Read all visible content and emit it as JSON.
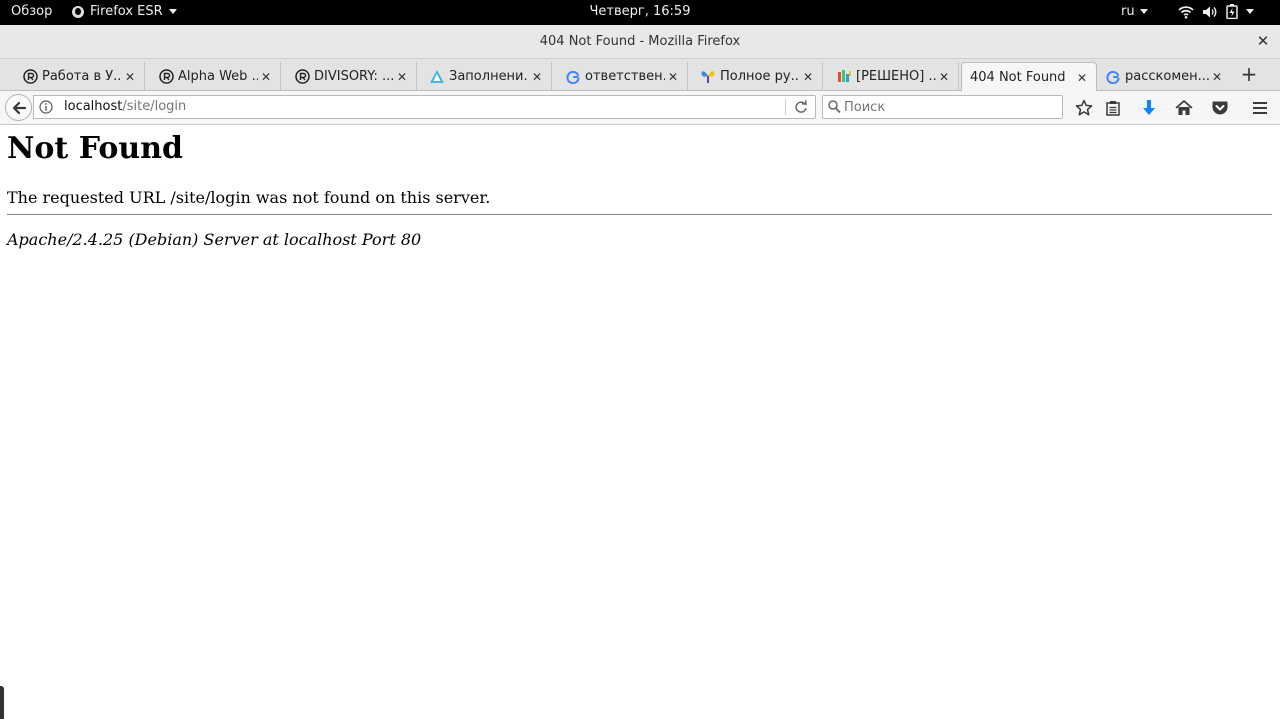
{
  "topbar": {
    "activities": "Обзор",
    "app_name": "Firefox ESR",
    "clock": "Четверг, 16:59",
    "language": "ru",
    "icons": [
      "wifi-icon",
      "volume-icon",
      "battery-icon"
    ]
  },
  "window": {
    "title": "404 Not Found - Mozilla Firefox"
  },
  "tabs": [
    {
      "label": "Работа в У...",
      "favicon": "circled-r-icon"
    },
    {
      "label": "Alpha Web ...",
      "favicon": "circled-r-icon"
    },
    {
      "label": "DIVISORY: ...",
      "favicon": "circled-r-icon"
    },
    {
      "label": "Заполнени...",
      "favicon": "triangle-logo-icon"
    },
    {
      "label": "ответствен...",
      "favicon": "google-icon"
    },
    {
      "label": "Полное ру...",
      "favicon": "butterfly-icon"
    },
    {
      "label": "[РЕШЕНО] ...",
      "favicon": "forum-icon"
    },
    {
      "label": "404 Not Found",
      "favicon": "none",
      "active": true
    },
    {
      "label": "расскомен...",
      "favicon": "google-icon"
    }
  ],
  "navbar": {
    "url_host": "localhost",
    "url_path": "/site/login",
    "search_placeholder": "Поиск"
  },
  "page": {
    "heading": "Not Found",
    "message": "The requested URL /site/login was not found on this server.",
    "server_signature": "Apache/2.4.25 (Debian) Server at localhost Port 80"
  },
  "colors": {
    "topbar_bg": "#000000",
    "download_arrow": "#0a84ff",
    "google_blue": "#4285f4"
  }
}
